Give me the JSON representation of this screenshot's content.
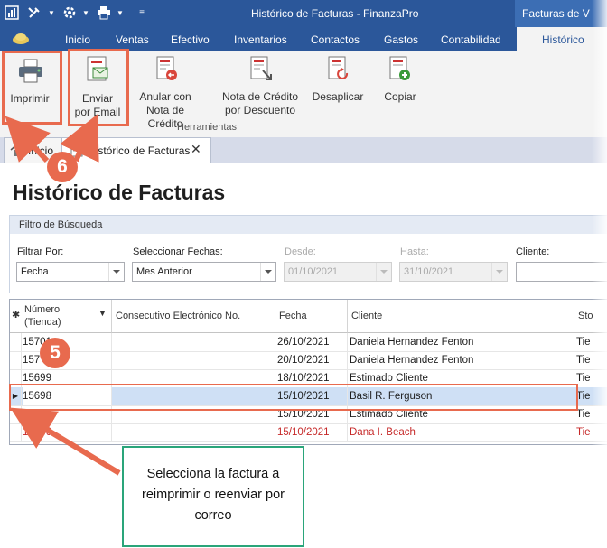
{
  "window": {
    "title": "Histórico de Facturas - FinanzaPro",
    "context_tab": "Facturas de V"
  },
  "quick_access": {
    "icons": [
      "app-icon",
      "tools-icon",
      "settings-icon",
      "print-quick-icon",
      "customize-icon"
    ]
  },
  "ribbon_tabs": [
    "Inicio",
    "Ventas",
    "Efectivo",
    "Inventarios",
    "Contactos",
    "Gastos",
    "Contabilidad"
  ],
  "ribbon_active_tab": "Histórico",
  "ribbon": {
    "buttons": {
      "print": "Imprimir",
      "email_1": "Enviar",
      "email_2": "por Email",
      "cancel_1": "Anular con",
      "cancel_2": "Nota de Crédito",
      "discount_1": "Nota de Crédito",
      "discount_2": "por Descuento",
      "unapply": "Desaplicar",
      "copy": "Copiar"
    },
    "group_label": "Herramientas"
  },
  "doc_tabs": {
    "home": "Inicio",
    "current": "Histórico de Facturas"
  },
  "page": {
    "title": "Histórico de Facturas"
  },
  "filter": {
    "header": "Filtro de Búsqueda",
    "filter_by_label": "Filtrar Por:",
    "filter_by_value": "Fecha",
    "dates_label": "Seleccionar Fechas:",
    "dates_value": "Mes Anterior",
    "from_label": "Desde:",
    "from_value": "01/10/2021",
    "to_label": "Hasta:",
    "to_value": "31/10/2021",
    "client_label": "Cliente:"
  },
  "grid": {
    "headers": {
      "number_1": "Número",
      "number_2": "(Tienda)",
      "electronic": "Consecutivo Electrónico No.",
      "date": "Fecha",
      "client": "Cliente",
      "store": "Sto"
    },
    "rows": [
      {
        "number": "15701",
        "date": "26/10/2021",
        "client": "Daniela Hernandez Fenton",
        "store": "Tie"
      },
      {
        "number": "157",
        "date": "20/10/2021",
        "client": "Daniela Hernandez Fenton",
        "store": "Tie"
      },
      {
        "number": "15699",
        "date": "18/10/2021",
        "client": "Estimado Cliente",
        "store": "Tie"
      },
      {
        "number": "15698",
        "date": "15/10/2021",
        "client": "Basil R. Ferguson",
        "store": "Tie"
      },
      {
        "number": "15697",
        "date": "15/10/2021",
        "client": "Estimado Cliente",
        "store": "Tie"
      },
      {
        "number": "15696",
        "date": "15/10/2021",
        "client": "Dana I. Beach",
        "store": "Tie"
      }
    ]
  },
  "annotations": {
    "step_5": "5",
    "step_6": "6",
    "callout": "Selecciona la factura a reimprimir o reenviar por correo"
  },
  "colors": {
    "ribbon_blue": "#2b579a",
    "annotation_red": "#e86a4e",
    "callout_green": "#2aa57a",
    "void_red": "#c62828",
    "selected_row": "#cfe0f5"
  }
}
